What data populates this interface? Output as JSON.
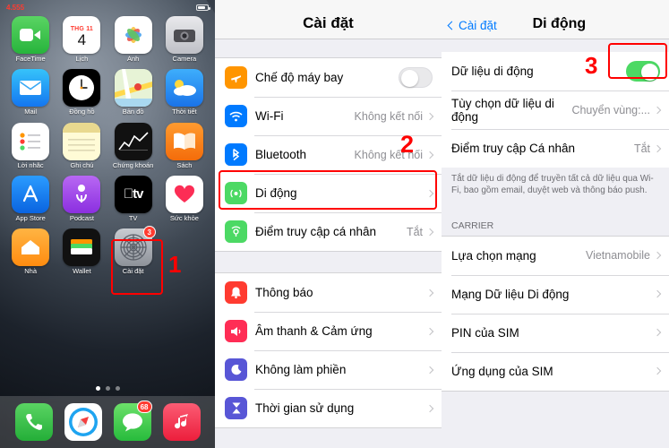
{
  "home": {
    "status": {
      "time": "4.555",
      "battery_icon": "battery-icon"
    },
    "apps": [
      {
        "label": "FaceTime",
        "icon": "facetime-icon",
        "badge": null
      },
      {
        "label": "Lịch",
        "icon": "calendar-icon",
        "cal_month": "THG 11",
        "cal_day": "4",
        "badge": null
      },
      {
        "label": "Ảnh",
        "icon": "photos-icon",
        "badge": null
      },
      {
        "label": "Camera",
        "icon": "camera-icon",
        "badge": null
      },
      {
        "label": "Mail",
        "icon": "mail-icon",
        "badge": null
      },
      {
        "label": "Đồng hồ",
        "icon": "clock-icon",
        "badge": null
      },
      {
        "label": "Bản đồ",
        "icon": "maps-icon",
        "badge": null
      },
      {
        "label": "Thời tiết",
        "icon": "weather-icon",
        "badge": null
      },
      {
        "label": "Lời nhắc",
        "icon": "reminders-icon",
        "badge": null
      },
      {
        "label": "Ghi chú",
        "icon": "notes-icon",
        "badge": null
      },
      {
        "label": "Chứng khoán",
        "icon": "stocks-icon",
        "badge": null
      },
      {
        "label": "Sách",
        "icon": "books-icon",
        "badge": null
      },
      {
        "label": "App Store",
        "icon": "appstore-icon",
        "badge": null
      },
      {
        "label": "Podcast",
        "icon": "podcast-icon",
        "badge": null
      },
      {
        "label": "TV",
        "icon": "tv-icon",
        "badge": null
      },
      {
        "label": "Sức khỏe",
        "icon": "health-icon",
        "badge": null
      },
      {
        "label": "Nhà",
        "icon": "home-icon",
        "badge": null
      },
      {
        "label": "Wallet",
        "icon": "wallet-icon",
        "badge": null
      },
      {
        "label": "Cài đặt",
        "icon": "settings-gear-icon",
        "badge": "3"
      }
    ],
    "dock": [
      {
        "label": "Điện thoại",
        "icon": "phone-icon",
        "badge": null
      },
      {
        "label": "Safari",
        "icon": "safari-icon",
        "badge": null
      },
      {
        "label": "Tin nhắn",
        "icon": "messages-icon",
        "badge": "68"
      },
      {
        "label": "Nhạc",
        "icon": "music-icon",
        "badge": null
      }
    ],
    "markers": {
      "one": "1"
    }
  },
  "settings": {
    "title": "Cài đặt",
    "markers": {
      "two": "2"
    },
    "group1": [
      {
        "label": "Chế độ máy bay",
        "icon": "airplane-icon",
        "control": "toggle",
        "toggle_on": false
      },
      {
        "label": "Wi-Fi",
        "icon": "wifi-icon",
        "value": "Không kết nối",
        "control": "chevron"
      },
      {
        "label": "Bluetooth",
        "icon": "bluetooth-icon",
        "value": "Không kết nối",
        "control": "chevron"
      },
      {
        "label": "Di động",
        "icon": "cellular-icon",
        "value": "",
        "control": "chevron",
        "highlighted": true
      },
      {
        "label": "Điểm truy cập cá nhân",
        "icon": "hotspot-icon",
        "value": "Tắt",
        "control": "chevron"
      }
    ],
    "group2": [
      {
        "label": "Thông báo",
        "icon": "notifications-icon",
        "control": "chevron"
      },
      {
        "label": "Âm thanh & Cảm ứng",
        "icon": "sounds-icon",
        "control": "chevron"
      },
      {
        "label": "Không làm phiền",
        "icon": "do-not-disturb-icon",
        "control": "chevron"
      },
      {
        "label": "Thời gian sử dụng",
        "icon": "screen-time-icon",
        "control": "chevron"
      }
    ]
  },
  "cellular": {
    "back_label": "Cài đặt",
    "title": "Di động",
    "markers": {
      "three": "3"
    },
    "group1": [
      {
        "label": "Dữ liệu di động",
        "control": "toggle",
        "toggle_on": true
      },
      {
        "label": "Tùy chọn dữ liệu di động",
        "value": "Chuyển vùng:...",
        "control": "chevron"
      },
      {
        "label": "Điểm truy cập Cá nhân",
        "value": "Tắt",
        "control": "chevron"
      }
    ],
    "footnote": "Tắt dữ liệu di động để truyền tất cả dữ liệu qua Wi-Fi, bao gồm email, duyệt web và thông báo push.",
    "section_header": "CARRIER",
    "group2": [
      {
        "label": "Lựa chọn mạng",
        "value": "Vietnamobile",
        "control": "chevron"
      },
      {
        "label": "Mạng Dữ liệu Di động",
        "value": "",
        "control": "chevron"
      },
      {
        "label": "PIN của SIM",
        "value": "",
        "control": "chevron"
      },
      {
        "label": "Ứng dụng của SIM",
        "value": "",
        "control": "chevron"
      }
    ]
  },
  "colors": {
    "accent": "#007aff",
    "marker_red": "#ff0000",
    "toggle_green": "#4cd964",
    "badge_red": "#ff3b30"
  }
}
